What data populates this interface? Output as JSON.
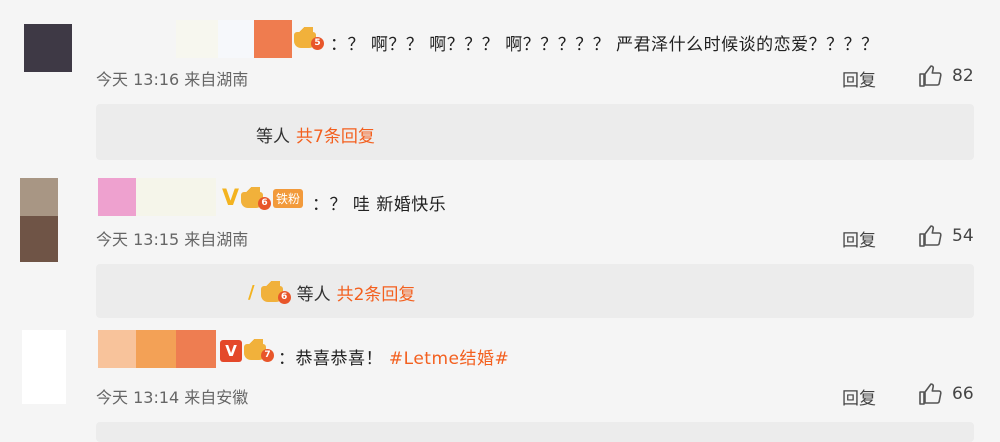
{
  "comments": [
    {
      "text": "：？ 啊？？ 啊？？？ 啊？？？？？ 严君泽什么时候谈的恋爱？？？？",
      "level": "5",
      "time": "今天 13:16 来自湖南",
      "reply_label": "回复",
      "likes": "82",
      "replies": {
        "who": "等人",
        "count": "共7条回复"
      }
    },
    {
      "text": "：？ 哇 新婚快乐",
      "level": "6",
      "fan_badge": "铁粉",
      "time": "今天 13:15 来自湖南",
      "reply_label": "回复",
      "likes": "54",
      "replies": {
        "who": "等人",
        "count": "共2条回复",
        "level": "6"
      }
    },
    {
      "text_prefix": "：恭喜恭喜！",
      "topic": "#Letme结婚#",
      "level": "7",
      "vip": "V",
      "time": "今天 13:14 来自安徽",
      "reply_label": "回复",
      "likes": "66"
    }
  ],
  "colors": {
    "background": "#f5f5f5",
    "reply_box": "#ececec",
    "accent_orange": "#f3601f",
    "crown_gold": "#f1b13b",
    "verified_yellow": "#f3b320"
  },
  "icons": [
    "thumbs-up-icon",
    "crown-icon",
    "verified-icon",
    "vip-icon"
  ]
}
